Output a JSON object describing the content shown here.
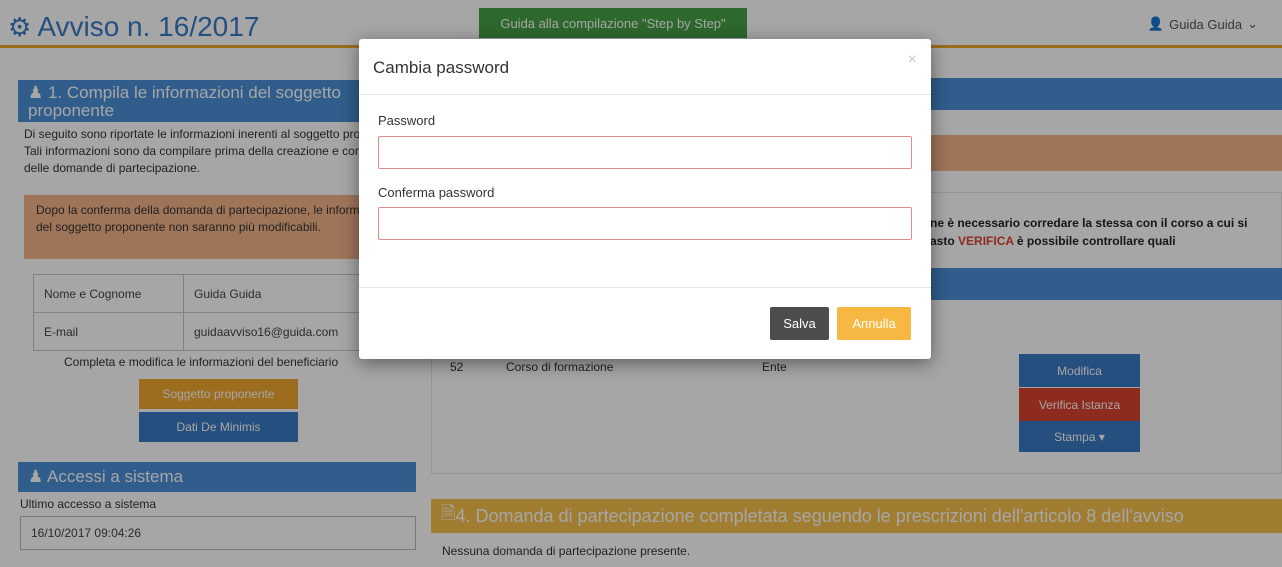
{
  "header": {
    "app_title": "Avviso n. 16/2017",
    "guide_button": "Guida alla compilazione \"Step by Step\"",
    "user_name": "Guida Guida",
    "user_icon": "user-icon",
    "gear_icon": "gears-icon"
  },
  "left": {
    "section1_title": "1. Compila le informazioni del soggetto proponente",
    "section1_text": "Di seguito sono riportate le informazioni inerenti al soggetto proponente. Tali informazioni sono da compilare prima della creazione e conferma delle domande di partecipazione.",
    "warning_text": "Dopo la conferma della domanda di partecipazione, le informazioni del soggetto proponente non saranno più modificabili.",
    "table": [
      {
        "label": "Nome e Cognome",
        "value": "Guida Guida"
      },
      {
        "label": "E-mail",
        "value": "guidaavviso16@guida.com"
      }
    ],
    "caption": "Completa e modifica le informazioni del beneficiario",
    "btn_soggetto": "Soggetto proponente",
    "btn_deminimis": "Dati De Minimis",
    "access_title": "Accessi a sistema",
    "access_label": "Ultimo accesso a sistema",
    "access_value": "16/10/2017 09:04:26"
  },
  "right": {
    "note_line1": "ne è necessario corredare la stessa con il corso a cui si",
    "note_line2_prefix": "asto ",
    "note_line2_highlight": "VERIFICA",
    "note_line2_suffix": " è possibile controllare quali",
    "course_id": "52",
    "course_type": "Corso di formazione",
    "course_ente": "Ente",
    "btn_modifica": "Modifica",
    "btn_verifica": "Verifica Istanza",
    "btn_stampa": "Stampa ▾",
    "domanda_title": "4. Domanda di partecipazione completata seguendo le prescrizioni dell'articolo 8 dell'avviso",
    "domanda_text": "Nessuna domanda di partecipazione presente."
  },
  "modal": {
    "title": "Cambia password",
    "close_symbol": "×",
    "password_label": "Password",
    "password_value": "",
    "confirm_label": "Conferma password",
    "confirm_value": "",
    "save_label": "Salva",
    "cancel_label": "Annulla"
  },
  "colors": {
    "primary": "#3a7ac4",
    "accent": "#f0a830",
    "warning_bg": "#f5b48a",
    "success": "#45a045",
    "danger": "#d9432f"
  }
}
